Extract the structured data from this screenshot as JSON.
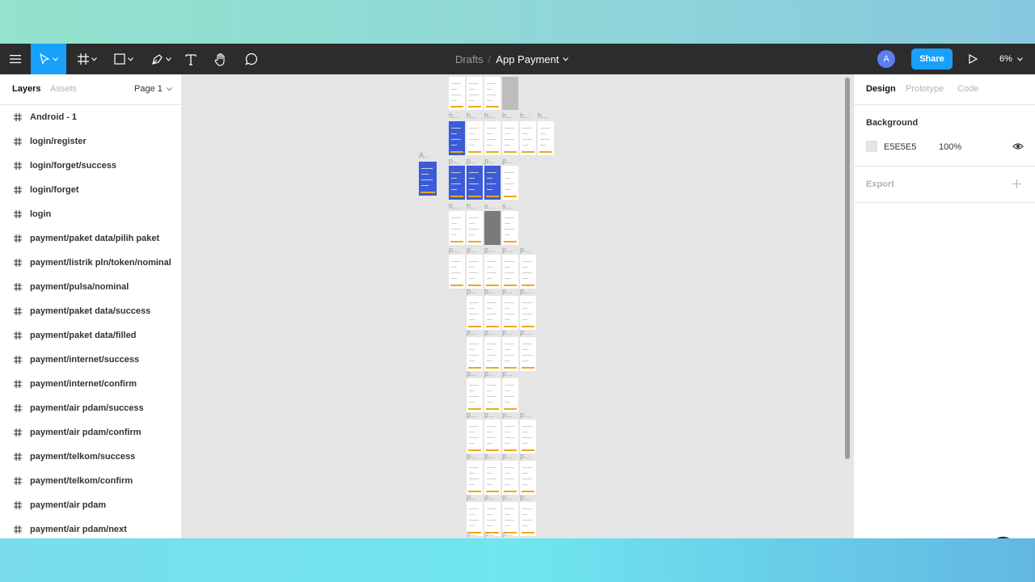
{
  "toolbar": {
    "breadcrumb_drafts": "Drafts",
    "breadcrumb_separator": "/",
    "file_name": "App Payment",
    "avatar_initial": "A",
    "share_label": "Share",
    "zoom_level": "6%",
    "accent_color": "#18a0fb",
    "icons": [
      "menu-icon",
      "move-tool-icon",
      "frame-tool-icon",
      "shape-tool-icon",
      "pen-tool-icon",
      "text-tool-icon",
      "hand-tool-icon",
      "comment-tool-icon",
      "play-icon"
    ]
  },
  "left_panel": {
    "tab_layers": "Layers",
    "tab_assets": "Assets",
    "page_selector": "Page 1",
    "layers": [
      "Android - 1",
      "login/register",
      "login/forget/success",
      "login/forget",
      "login",
      "payment/paket data/pilih paket",
      "payment/listrik pln/token/nominal",
      "payment/pulsa/nominal",
      "payment/paket data/success",
      "payment/paket data/filled",
      "payment/internet/success",
      "payment/internet/confirm",
      "payment/air pdam/success",
      "payment/air pdam/confirm",
      "payment/telkom/success",
      "payment/telkom/confirm",
      "payment/air pdam",
      "payment/air pdam/next"
    ]
  },
  "right_panel": {
    "tab_design": "Design",
    "tab_prototype": "Prototype",
    "tab_code": "Code",
    "background_title": "Background",
    "background_hex": "E5E5E5",
    "background_opacity": "100%",
    "export_title": "Export"
  },
  "canvas": {
    "background_color": "#e5e5e5",
    "frame_labels": [
      "A...",
      "h...",
      "p...",
      "s..."
    ]
  },
  "help_label": "?"
}
